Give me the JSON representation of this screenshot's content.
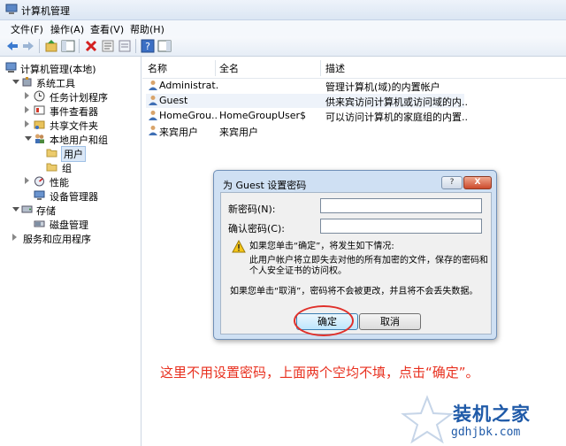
{
  "window": {
    "title": "计算机管理"
  },
  "menu": [
    "文件(F)",
    "操作(A)",
    "查看(V)",
    "帮助(H)"
  ],
  "tree": {
    "root": "计算机管理(本地)",
    "items": [
      "系统工具",
      "任务计划程序",
      "事件查看器",
      "共享文件夹",
      "本地用户和组",
      "用户",
      "组",
      "性能",
      "设备管理器",
      "存储",
      "磁盘管理",
      "服务和应用程序"
    ]
  },
  "list": {
    "columns": [
      "名称",
      "全名",
      "描述"
    ],
    "rows": [
      {
        "name": "Administrat...",
        "fullname": "",
        "desc": "管理计算机(域)的内置帐户"
      },
      {
        "name": "Guest",
        "fullname": "",
        "desc": "供来宾访问计算机或访问域的内..."
      },
      {
        "name": "HomeGrou...",
        "fullname": "HomeGroupUser$",
        "desc": "可以访问计算机的家庭组的内置..."
      },
      {
        "name": "来宾用户",
        "fullname": "来宾用户",
        "desc": ""
      }
    ]
  },
  "dialog": {
    "title": "为 Guest 设置密码",
    "help_button": "?",
    "close_button": "X",
    "new_password_label": "新密码(N):",
    "confirm_password_label": "确认密码(C):",
    "new_password_value": "",
    "confirm_password_value": "",
    "warning_line1": "如果您单击“确定”，将发生如下情况:",
    "warning_line2": "此用户帐户将立即失去对他的所有加密的文件，保存的密码和",
    "warning_line3": "个人安全证书的访问权。",
    "cancel_note": "如果您单击“取消”，密码将不会被更改，并且将不会丢失数据。",
    "ok_label": "确定",
    "cancel_label": "取消"
  },
  "annotation": "这里不用设置密码，上面两个空均不填，点击“确定”。",
  "watermark": {
    "title": "装机之家",
    "url": "gdhjbk.com"
  },
  "colors": {
    "annotation": "#e8301f",
    "highlight_ring": "#e0302a",
    "watermark": "#1f5aa8"
  }
}
